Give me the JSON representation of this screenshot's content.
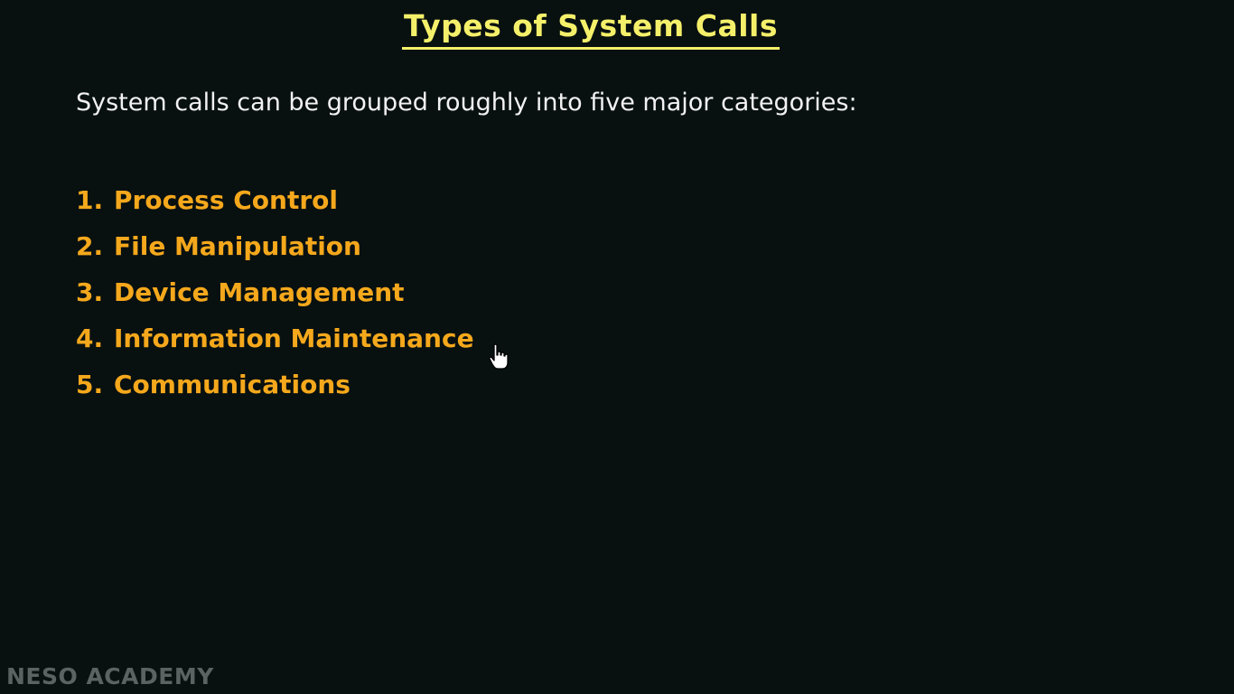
{
  "slide": {
    "title": "Types of System Calls",
    "intro": "System calls can be grouped roughly into five major categories:",
    "categories": [
      {
        "number": "1.",
        "label": "Process Control"
      },
      {
        "number": "2.",
        "label": "File Manipulation"
      },
      {
        "number": "3.",
        "label": "Device Management"
      },
      {
        "number": "4.",
        "label": "Information Maintenance"
      },
      {
        "number": "5.",
        "label": "Communications"
      }
    ]
  },
  "watermark": "NESO ACADEMY",
  "colors": {
    "background": "#081010",
    "title": "#f5f06a",
    "intro_text": "#f2f2f2",
    "list_text": "#f5a81c",
    "watermark": "#5a6262"
  },
  "icons": {
    "cursor": "hand-pointer-icon"
  }
}
